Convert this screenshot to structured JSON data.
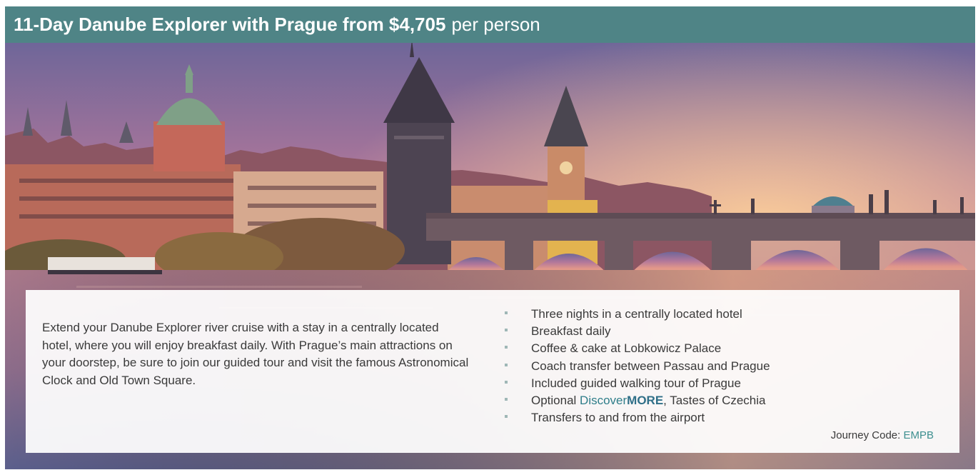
{
  "header": {
    "title_bold": "11-Day Danube Explorer with Prague from $4,705",
    "title_suffix": "per person"
  },
  "hero_image": {
    "icon": "prague-charles-bridge-sunset-photo",
    "colors": {
      "sky_top": "#7d6a9c",
      "sky_mid": "#d98a7f",
      "sky_glow": "#f2b48a",
      "water": "#8a6f88"
    }
  },
  "description": "Extend your Danube Explorer river cruise with a stay in a centrally located hotel, where you will enjoy breakfast daily. With Prague’s main attractions on your doorstep, be sure to join our guided tour and visit the famous Astronomical Clock and Old Town Square.",
  "features": [
    {
      "text": "Three nights in a centrally located hotel"
    },
    {
      "text": "Breakfast daily"
    },
    {
      "text": "Coffee & cake at Lobkowicz Palace"
    },
    {
      "text": "Coach transfer between Passau and Prague"
    },
    {
      "text": "Included guided walking tour of Prague"
    },
    {
      "prefix": "Optional ",
      "link_a": "Discover",
      "link_b": "MORE",
      "suffix": ", Tastes of Czechia"
    },
    {
      "text": "Transfers to and from the airport"
    }
  ],
  "journey": {
    "label": "Journey Code: ",
    "code": "EMPB"
  },
  "colors": {
    "header_bg": "#4f8486",
    "bullet": "#9fb7b6",
    "accent": "#2f7e8a"
  }
}
